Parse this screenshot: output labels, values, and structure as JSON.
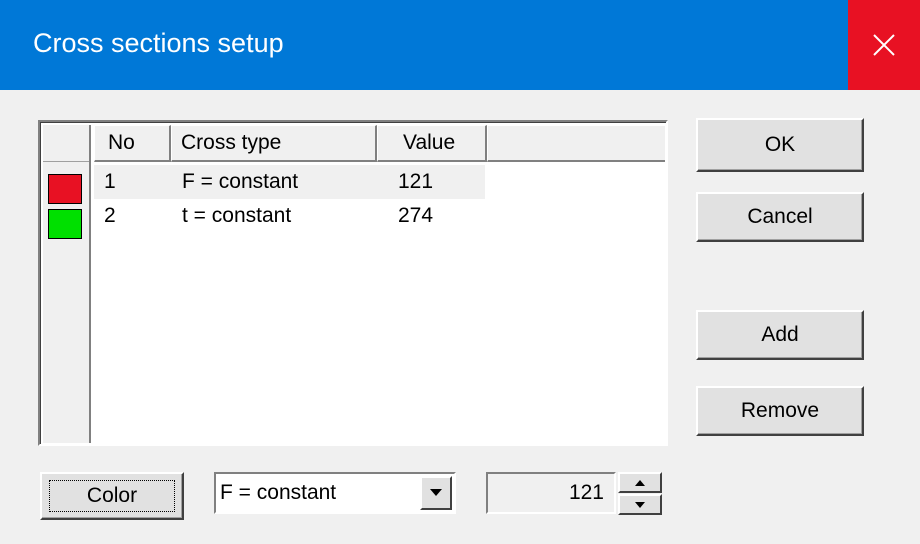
{
  "window": {
    "title": "Cross sections setup"
  },
  "list": {
    "columns": [
      "No",
      "Cross type",
      "Value"
    ],
    "rows": [
      {
        "no": "1",
        "type": "F = constant",
        "value": "121",
        "color": "#e81123"
      },
      {
        "no": "2",
        "type": "t = constant",
        "value": "274",
        "color": "#00e000"
      }
    ]
  },
  "buttons": {
    "ok": "OK",
    "cancel": "Cancel",
    "add": "Add",
    "remove": "Remove",
    "color": "Color"
  },
  "combo": {
    "value": "F = constant"
  },
  "spin": {
    "value": "121"
  },
  "colors": {
    "titlebar": "#0078d7",
    "close": "#e81123"
  }
}
